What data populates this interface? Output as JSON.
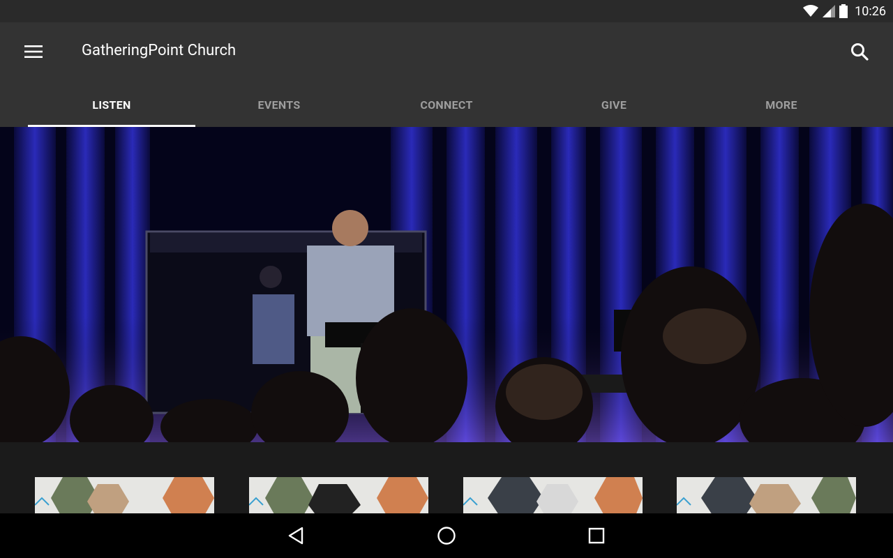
{
  "status_bar": {
    "time": "10:26"
  },
  "app_bar": {
    "title": "GatheringPoint Church"
  },
  "tabs": [
    {
      "label": "LISTEN",
      "active": true
    },
    {
      "label": "EVENTS",
      "active": false
    },
    {
      "label": "CONNECT",
      "active": false
    },
    {
      "label": "GIVE",
      "active": false
    },
    {
      "label": "MORE",
      "active": false
    }
  ],
  "hero": {
    "icon": "sermon-photo"
  },
  "sermon_thumbnails": [
    {
      "icon": "sermon-series-thumbnail"
    },
    {
      "icon": "sermon-series-thumbnail"
    },
    {
      "icon": "sermon-series-thumbnail"
    },
    {
      "icon": "sermon-series-thumbnail"
    }
  ],
  "colors": {
    "app_bar": "#333333",
    "status_bar": "#2a2a2a",
    "tab_inactive": "#9e9e9e",
    "tab_active": "#ffffff"
  }
}
